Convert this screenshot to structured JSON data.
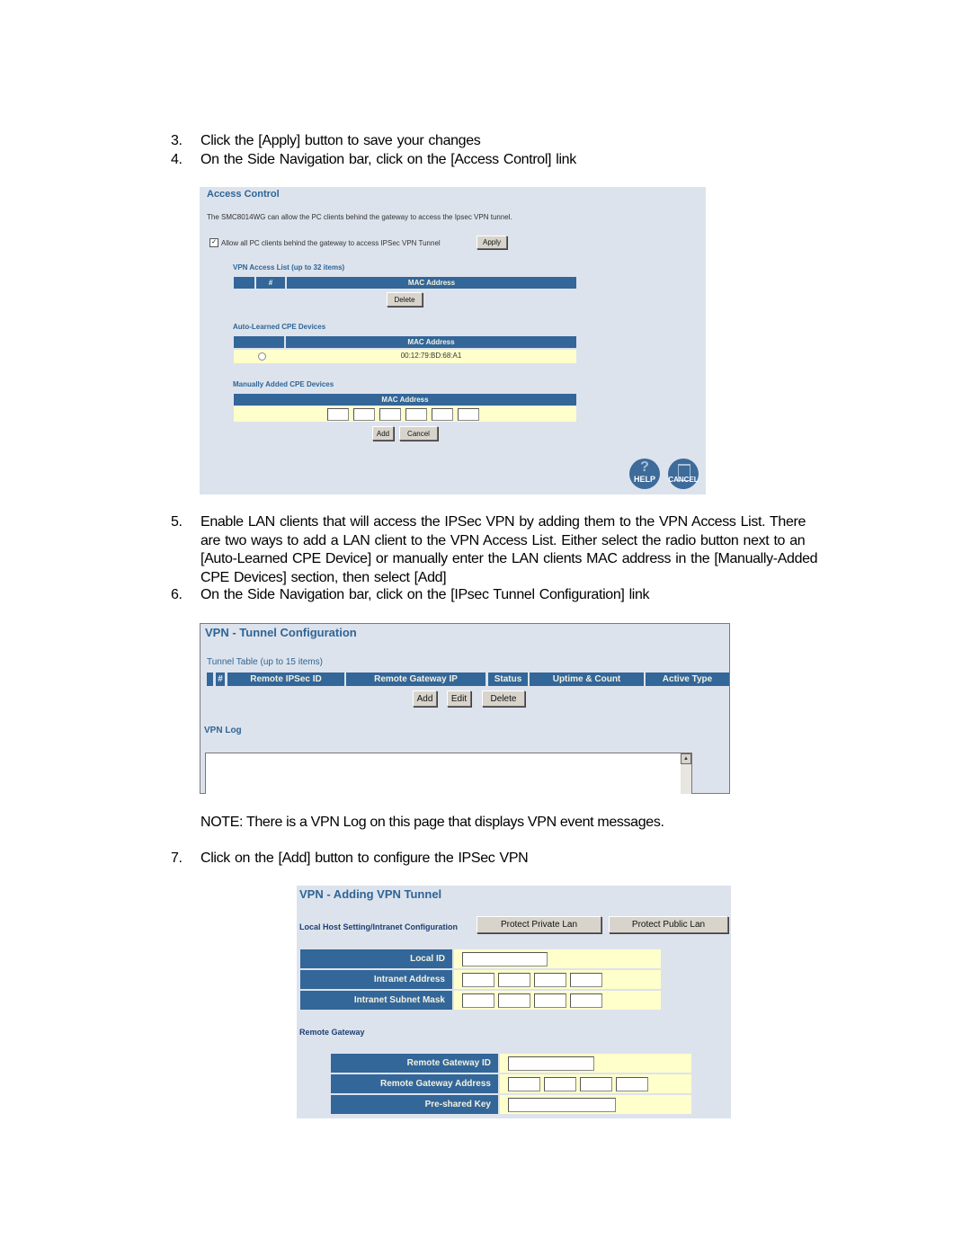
{
  "steps": [
    {
      "num": "3.",
      "text": "Click the [Apply] button to save your changes"
    },
    {
      "num": "4.",
      "text": "On the Side Navigation bar, click on the [Access Control] link"
    },
    {
      "num": "5.",
      "text": "Enable LAN clients that will access the IPSec VPN by adding them to the VPN Access List.  There are two ways to add a LAN client to the VPN Access List.  Either select the radio button next to an [Auto-Learned CPE Device] or manually enter the LAN clients MAC address in the [Manually-Added CPE Devices] section, then select [Add]"
    },
    {
      "num": "6.",
      "text": "On the Side Navigation bar, click on the [IPsec Tunnel Configuration] link"
    },
    {
      "num": "7.",
      "text": "Click on the [Add] button to configure the IPSec VPN"
    }
  ],
  "note": "NOTE: There is a VPN Log on this page that displays VPN event messages.",
  "access_control": {
    "title": "Access Control",
    "description": "The SMC8014WG can allow the PC clients behind the gateway to access the Ipsec VPN tunnel.",
    "allow_checkbox_label": "Allow all PC clients behind the gateway to access IPSec VPN Tunnel",
    "allow_checked": true,
    "apply_label": "Apply",
    "vpn_access_list": {
      "title": "VPN Access List (up to 32 items)",
      "columns": [
        "",
        "#",
        "MAC Address"
      ],
      "rows": [],
      "delete_label": "Delete"
    },
    "auto_learned": {
      "title": "Auto-Learned CPE Devices",
      "columns": [
        "",
        "MAC Address"
      ],
      "rows": [
        {
          "selected": false,
          "mac": "00:12:79:BD:68:A1"
        }
      ]
    },
    "manually_added": {
      "title": "Manually Added CPE Devices",
      "column": "MAC Address",
      "octets": [
        "",
        "",
        "",
        "",
        "",
        ""
      ],
      "add_label": "Add",
      "cancel_label": "Cancel"
    },
    "help_label": "HELP",
    "cancel_icon_label": "CANCEL"
  },
  "tunnel_config": {
    "title": "VPN - Tunnel Configuration",
    "table_title": "Tunnel Table (up to 15 items)",
    "columns": [
      "",
      "#",
      "Remote IPSec ID",
      "Remote Gateway IP",
      "Status",
      "Uptime & Count",
      "Active Type"
    ],
    "rows": [],
    "add_label": "Add",
    "edit_label": "Edit",
    "delete_label": "Delete",
    "log_title": "VPN Log",
    "log_content": ""
  },
  "adding_tunnel": {
    "title": "VPN - Adding VPN Tunnel",
    "local_host_label": "Local Host Setting/Intranet Configuration",
    "protect_private_label": "Protect Private Lan",
    "protect_public_label": "Protect Public Lan",
    "local_fields": [
      {
        "label": "Local ID",
        "type": "text",
        "value": ""
      },
      {
        "label": "Intranet Address",
        "type": "ip",
        "value": [
          "",
          "",
          "",
          ""
        ]
      },
      {
        "label": "Intranet Subnet Mask",
        "type": "ip",
        "value": [
          "",
          "",
          "",
          ""
        ]
      }
    ],
    "remote_gateway_label": "Remote Gateway",
    "remote_fields": [
      {
        "label": "Remote Gateway ID",
        "type": "text",
        "value": ""
      },
      {
        "label": "Remote Gateway Address",
        "type": "ip",
        "value": [
          "",
          "",
          "",
          ""
        ]
      },
      {
        "label": "Pre-shared Key",
        "type": "text",
        "value": ""
      }
    ]
  }
}
